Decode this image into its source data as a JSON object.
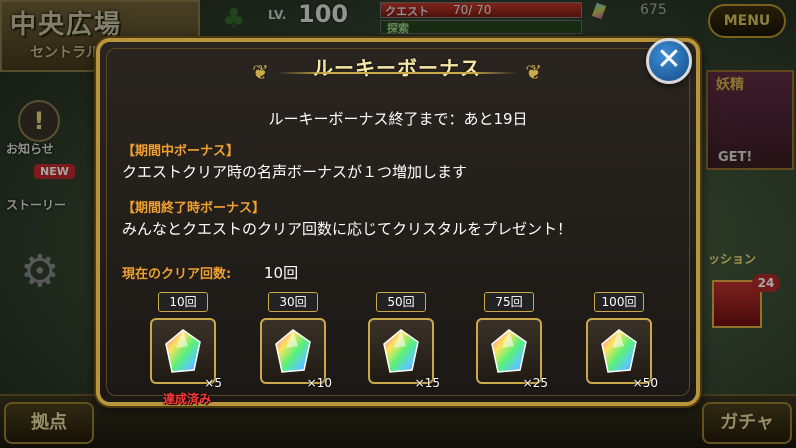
{
  "background": {
    "location_title": "中央広場",
    "location_subtitle": "セントラル",
    "level_label": "LV.",
    "level_value": "100",
    "quest_label": "クエスト",
    "quest_value": "70/ 70",
    "quest_progress": 1.0,
    "explore_label": "探索",
    "crystal_count": "675",
    "menu_label": "MENU",
    "notice_label": "お知らせ",
    "new_tag": "NEW",
    "story_label": "ストーリー",
    "ad_title": "妖精",
    "ad_sub": "GET!",
    "mission_label": "ッション",
    "present_badge": "24",
    "home_label": "拠点",
    "gacha_label": "ガチャ"
  },
  "modal": {
    "title": "ルーキーボーナス",
    "remaining_text": "ルーキーボーナス終了まで：あと19日",
    "period_bonus_heading": "【期間中ボーナス】",
    "period_bonus_text": "クエストクリア時の名声ボーナスが１つ増加します",
    "end_bonus_heading": "【期間終了時ボーナス】",
    "end_bonus_text": "みんなとクエストのクリア回数に応じてクリスタルをプレゼント！",
    "clear_count_label": "現在のクリア回数:",
    "clear_count_value": "10回",
    "tiers": [
      {
        "label": "10回",
        "qty": "×5",
        "status": "達成済み"
      },
      {
        "label": "30回",
        "qty": "×10",
        "status": ""
      },
      {
        "label": "50回",
        "qty": "×15",
        "status": ""
      },
      {
        "label": "75回",
        "qty": "×25",
        "status": ""
      },
      {
        "label": "100回",
        "qty": "×50",
        "status": ""
      }
    ],
    "close_icon": "close-icon",
    "reward_icon": "rainbow-crystal-icon"
  }
}
